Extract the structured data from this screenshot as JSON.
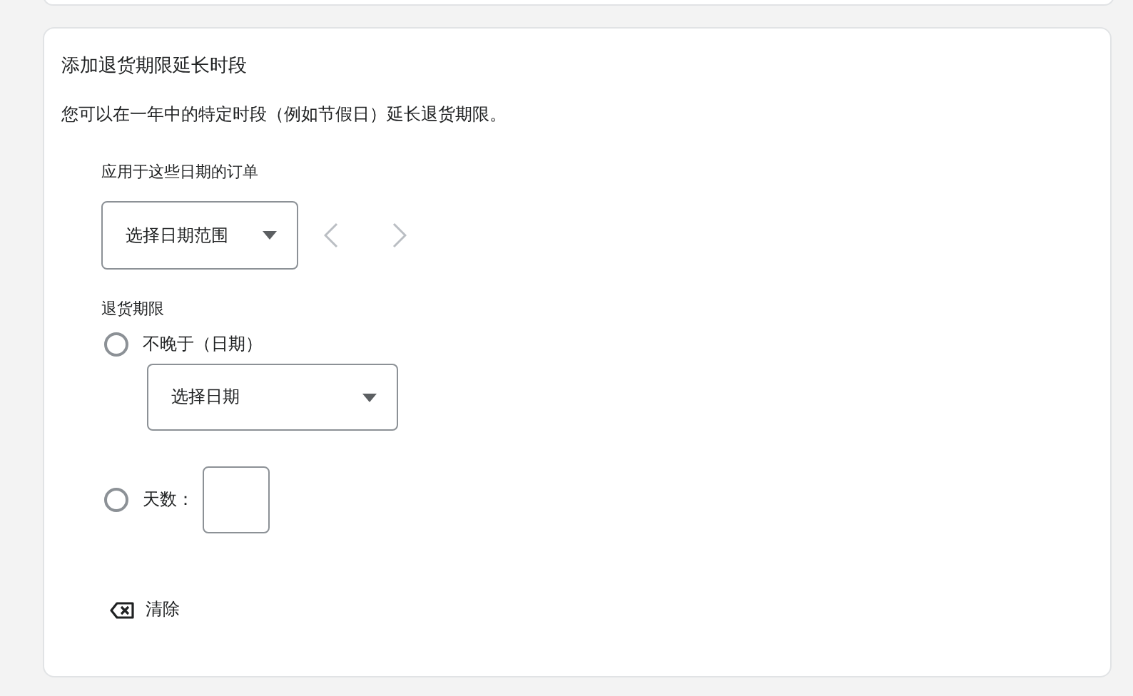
{
  "title": "添加退货期限延长时段",
  "description": "您可以在一年中的特定时段（例如节假日）延长退货期限。",
  "date_range": {
    "label": "应用于这些日期的订单",
    "placeholder": "选择日期范围"
  },
  "return_deadline": {
    "label": "退货期限",
    "options": [
      {
        "kind": "date",
        "label": "不晚于（日期）",
        "selected": false,
        "placeholder": "选择日期"
      },
      {
        "kind": "days",
        "label": "天数：",
        "selected": false
      }
    ]
  },
  "clear_button": "清除"
}
